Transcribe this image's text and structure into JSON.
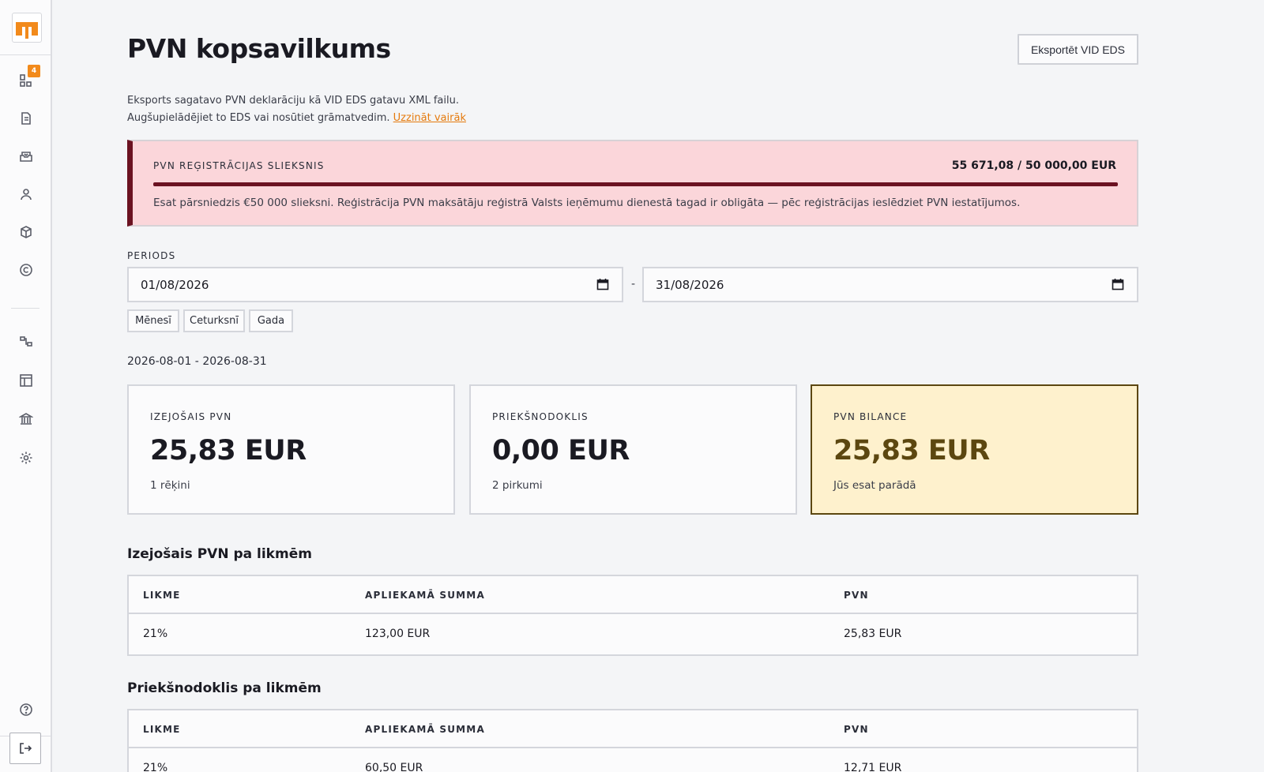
{
  "sidebar": {
    "badge_count": "4",
    "items": [
      {
        "name": "dashboard",
        "icon": "dashboard-icon"
      },
      {
        "name": "invoices",
        "icon": "document-icon"
      },
      {
        "name": "inbox",
        "icon": "inbox-icon"
      },
      {
        "name": "clients",
        "icon": "user-icon"
      },
      {
        "name": "products",
        "icon": "box-icon"
      },
      {
        "name": "copyright",
        "icon": "copyright-icon"
      },
      {
        "name": "integrations",
        "icon": "connections-icon"
      },
      {
        "name": "templates",
        "icon": "layout-icon"
      },
      {
        "name": "bank",
        "icon": "bank-icon"
      },
      {
        "name": "settings",
        "icon": "gear-icon"
      }
    ],
    "help_icon": "help-icon",
    "logout_icon": "logout-icon"
  },
  "page": {
    "title": "PVN kopsavilkums",
    "export_label": "Eksportēt VID EDS",
    "intro_line1": "Eksports sagatavo PVN deklarāciju kā VID EDS gatavu XML failu.",
    "intro_line2": "Augšupielādējiet to EDS vai nosūtiet grāmatvedim.",
    "learn_more": "Uzzināt vairāk"
  },
  "threshold": {
    "label": "PVN REĢISTRĀCIJAS SLIEKSNIS",
    "amount": "55 671,08 / 50 000,00 EUR",
    "progress": 1.0,
    "message": "Esat pārsniedzis €50 000 slieksni. Reģistrācija PVN maksātāju reģistrā Valsts ieņēmumu dienestā tagad ir obligāta — pēc reģistrācijas ieslēdziet PVN iestatījumos.",
    "color": "#6b1221"
  },
  "period": {
    "label": "PERIODS",
    "from": "01/08/2026",
    "to": "31/08/2026",
    "separator": "-",
    "chips": [
      "Mēnesī",
      "Ceturksnī",
      "Gada"
    ],
    "range_text": "2026-08-01 - 2026-08-31"
  },
  "cards": [
    {
      "label": "IZEJOŠAIS PVN",
      "value": "25,83 EUR",
      "sub": "1 rēķini"
    },
    {
      "label": "PRIEKŠNODOKLIS",
      "value": "0,00 EUR",
      "sub": "2 pirkumi"
    },
    {
      "label": "PVN BILANCE",
      "value": "25,83 EUR",
      "sub": "Jūs esat parādā"
    }
  ],
  "output_table": {
    "title": "Izejošais PVN pa likmēm",
    "headers": [
      "LIKME",
      "APLIEKAMĀ SUMMA",
      "PVN"
    ],
    "rows": [
      [
        "21%",
        "123,00 EUR",
        "25,83 EUR"
      ]
    ]
  },
  "input_table": {
    "title": "Priekšnodoklis pa likmēm",
    "headers": [
      "LIKME",
      "APLIEKAMĀ SUMMA",
      "PVN"
    ],
    "rows": [
      [
        "21%",
        "60,50 EUR",
        "12,71 EUR"
      ]
    ]
  }
}
